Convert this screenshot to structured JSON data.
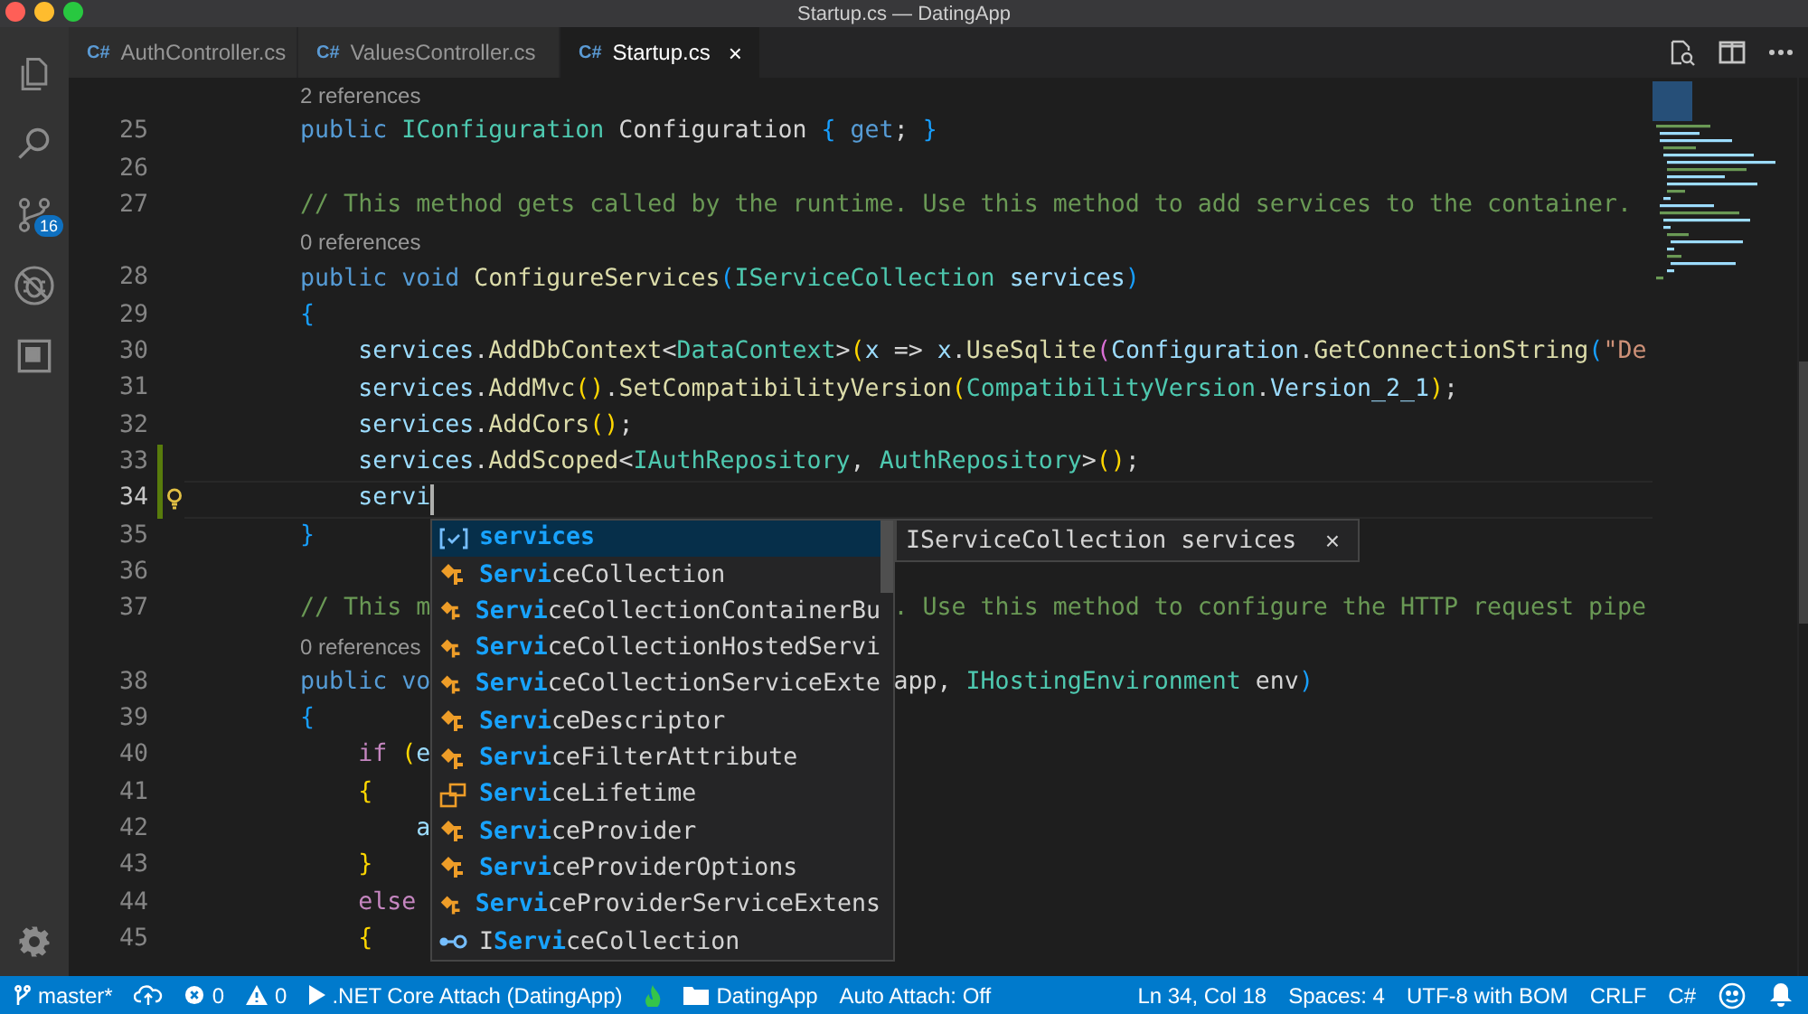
{
  "window": {
    "title": "Startup.cs — DatingApp"
  },
  "activity_bar": {
    "items": [
      {
        "kind": "files"
      },
      {
        "kind": "search"
      },
      {
        "kind": "source-control",
        "badge": "16"
      },
      {
        "kind": "debug"
      },
      {
        "kind": "extensions"
      }
    ],
    "bottom": [
      {
        "kind": "settings"
      }
    ]
  },
  "tabs": [
    {
      "icon": "C#",
      "label": "AuthController.cs",
      "selected": false
    },
    {
      "icon": "C#",
      "label": "ValuesController.cs",
      "selected": false
    },
    {
      "icon": "C#",
      "label": "Startup.cs",
      "selected": true,
      "close": "×"
    }
  ],
  "editor_actions": [
    {
      "kind": "find-in-file"
    },
    {
      "kind": "split"
    },
    {
      "kind": "more"
    }
  ],
  "editor": {
    "lines": [
      {
        "kind": "lens",
        "text": "2 references"
      },
      {
        "kind": "code",
        "number": "25",
        "tokens": [
          {
            "t": "        public ",
            "kind": "kw"
          },
          {
            "t": "IConfiguration",
            "kind": "type"
          },
          {
            "t": " Configuration ",
            "kind": "plain"
          },
          {
            "t": "{",
            "kind": "b3"
          },
          {
            "t": " get",
            "kind": "kw"
          },
          {
            "t": "; ",
            "kind": "plain"
          },
          {
            "t": "}",
            "kind": "b3"
          }
        ]
      },
      {
        "kind": "code",
        "number": "26"
      },
      {
        "kind": "code",
        "number": "27",
        "tokens": [
          {
            "t": "        // This method gets called by the runtime. Use this method to add services to the container.",
            "kind": "comment"
          }
        ]
      },
      {
        "kind": "lens",
        "text": "0 references"
      },
      {
        "kind": "code",
        "number": "28",
        "tokens": [
          {
            "t": "        public void ",
            "kind": "kw"
          },
          {
            "t": "ConfigureServices",
            "kind": "func"
          },
          {
            "t": "(",
            "kind": "b3"
          },
          {
            "t": "IServiceCollection",
            "kind": "type"
          },
          {
            "t": " services",
            "kind": "var"
          },
          {
            "t": ")",
            "kind": "b3"
          }
        ]
      },
      {
        "kind": "code",
        "number": "29",
        "tokens": [
          {
            "t": "        {",
            "kind": "b3"
          }
        ]
      },
      {
        "kind": "code",
        "number": "30",
        "tokens": [
          {
            "t": "            services",
            "kind": "var"
          },
          {
            "t": ".",
            "kind": "plain"
          },
          {
            "t": "AddDbContext",
            "kind": "func"
          },
          {
            "t": "<",
            "kind": "plain"
          },
          {
            "t": "DataContext",
            "kind": "type"
          },
          {
            "t": ">",
            "kind": "plain"
          },
          {
            "t": "(",
            "kind": "b1"
          },
          {
            "t": "x",
            "kind": "var"
          },
          {
            "t": " => ",
            "kind": "plain"
          },
          {
            "t": "x",
            "kind": "var"
          },
          {
            "t": ".",
            "kind": "plain"
          },
          {
            "t": "UseSqlite",
            "kind": "func"
          },
          {
            "t": "(",
            "kind": "b2"
          },
          {
            "t": "Configuration",
            "kind": "var"
          },
          {
            "t": ".",
            "kind": "plain"
          },
          {
            "t": "GetConnectionString",
            "kind": "func"
          },
          {
            "t": "(",
            "kind": "b3"
          },
          {
            "t": "\"De",
            "kind": "str"
          }
        ]
      },
      {
        "kind": "code",
        "number": "31",
        "tokens": [
          {
            "t": "            services",
            "kind": "var"
          },
          {
            "t": ".",
            "kind": "plain"
          },
          {
            "t": "AddMvc",
            "kind": "func"
          },
          {
            "t": "()",
            "kind": "b1"
          },
          {
            "t": ".",
            "kind": "plain"
          },
          {
            "t": "SetCompatibilityVersion",
            "kind": "func"
          },
          {
            "t": "(",
            "kind": "b1"
          },
          {
            "t": "CompatibilityVersion",
            "kind": "type"
          },
          {
            "t": ".",
            "kind": "plain"
          },
          {
            "t": "Version_2_1",
            "kind": "var"
          },
          {
            "t": ")",
            "kind": "b1"
          },
          {
            "t": ";",
            "kind": "plain"
          }
        ]
      },
      {
        "kind": "code",
        "number": "32",
        "tokens": [
          {
            "t": "            services",
            "kind": "var"
          },
          {
            "t": ".",
            "kind": "plain"
          },
          {
            "t": "AddCors",
            "kind": "func"
          },
          {
            "t": "()",
            "kind": "b1"
          },
          {
            "t": ";",
            "kind": "plain"
          }
        ]
      },
      {
        "kind": "code",
        "number": "33",
        "modified": true,
        "tokens": [
          {
            "t": "            services",
            "kind": "var"
          },
          {
            "t": ".",
            "kind": "plain"
          },
          {
            "t": "AddScoped",
            "kind": "func"
          },
          {
            "t": "<",
            "kind": "plain"
          },
          {
            "t": "IAuthRepository",
            "kind": "type"
          },
          {
            "t": ", ",
            "kind": "plain"
          },
          {
            "t": "AuthRepository",
            "kind": "type"
          },
          {
            "t": ">",
            "kind": "plain"
          },
          {
            "t": "()",
            "kind": "b1"
          },
          {
            "t": ";",
            "kind": "plain"
          }
        ]
      },
      {
        "kind": "code",
        "number": "34",
        "modified": true,
        "lightbulb": true,
        "cursor": true,
        "tokens": [
          {
            "t": "            servi",
            "kind": "var"
          }
        ]
      },
      {
        "kind": "code",
        "number": "35",
        "tokens": [
          {
            "t": "        }",
            "kind": "b3"
          }
        ]
      },
      {
        "kind": "code",
        "number": "36"
      },
      {
        "kind": "code",
        "number": "37",
        "tokens": [
          {
            "t": "        // This m",
            "kind": "comment"
          }
        ],
        "tail": [
          {
            "t": ". Use this method to configure the HTTP request pipe",
            "kind": "comment"
          }
        ]
      },
      {
        "kind": "lens",
        "text": "0 references"
      },
      {
        "kind": "code",
        "number": "38",
        "tokens": [
          {
            "t": "        public vo",
            "kind": "kw"
          }
        ],
        "tail": [
          {
            "t": "app, ",
            "kind": "plain"
          },
          {
            "t": "IHostingEnvironment",
            "kind": "type"
          },
          {
            "t": " env",
            "kind": "plain"
          },
          {
            "t": ")",
            "kind": "b3"
          }
        ]
      },
      {
        "kind": "code",
        "number": "39",
        "tokens": [
          {
            "t": "        {",
            "kind": "b3"
          }
        ]
      },
      {
        "kind": "code",
        "number": "40",
        "tokens": [
          {
            "t": "            if ",
            "kind": "ctrl"
          },
          {
            "t": "(",
            "kind": "b1"
          },
          {
            "t": "e",
            "kind": "var"
          }
        ]
      },
      {
        "kind": "code",
        "number": "41",
        "tokens": [
          {
            "t": "            {",
            "kind": "b1"
          }
        ]
      },
      {
        "kind": "code",
        "number": "42",
        "tokens": [
          {
            "t": "                a",
            "kind": "var"
          }
        ]
      },
      {
        "kind": "code",
        "number": "43",
        "tokens": [
          {
            "t": "            }",
            "kind": "b1"
          }
        ]
      },
      {
        "kind": "code",
        "number": "44",
        "tokens": [
          {
            "t": "            else",
            "kind": "ctrl"
          }
        ]
      },
      {
        "kind": "code",
        "number": "45",
        "tokens": [
          {
            "t": "            {",
            "kind": "b1"
          }
        ]
      }
    ]
  },
  "suggest": {
    "items": [
      {
        "kind": "variable",
        "match": "servi",
        "rest": "ces",
        "selected": true
      },
      {
        "kind": "class",
        "match": "Servi",
        "rest": "ceCollection",
        "selected": false
      },
      {
        "kind": "class",
        "match": "Servi",
        "rest": "ceCollectionContainerBu",
        "selected": false
      },
      {
        "kind": "class",
        "match": "Servi",
        "rest": "ceCollectionHostedServi",
        "selected": false
      },
      {
        "kind": "class",
        "match": "Servi",
        "rest": "ceCollectionServiceExte",
        "selected": false
      },
      {
        "kind": "class",
        "match": "Servi",
        "rest": "ceDescriptor",
        "selected": false
      },
      {
        "kind": "class",
        "match": "Servi",
        "rest": "ceFilterAttribute",
        "selected": false
      },
      {
        "kind": "enum",
        "match": "Servi",
        "rest": "ceLifetime",
        "selected": false
      },
      {
        "kind": "class",
        "match": "Servi",
        "rest": "ceProvider",
        "selected": false
      },
      {
        "kind": "class",
        "match": "Servi",
        "rest": "ceProviderOptions",
        "selected": false
      },
      {
        "kind": "class",
        "match": "Servi",
        "rest": "ceProviderServiceExtens",
        "selected": false
      },
      {
        "kind": "interface",
        "pre": "I",
        "match": "Servi",
        "rest": "ceCollection",
        "selected": false
      }
    ],
    "detail": {
      "text": "IServiceCollection services",
      "close": "×"
    }
  },
  "status_bar": {
    "left": [
      {
        "kind": "branch",
        "text": "master*"
      },
      {
        "kind": "cloud"
      },
      {
        "kind": "error",
        "text": "0"
      },
      {
        "kind": "warning",
        "text": "0"
      },
      {
        "kind": "play",
        "text": ".NET Core Attach (DatingApp)"
      },
      {
        "kind": "flame"
      },
      {
        "kind": "folder",
        "text": "DatingApp"
      },
      {
        "kind": "text",
        "text": "Auto Attach: Off"
      }
    ],
    "right": [
      {
        "kind": "text",
        "text": "Ln 34, Col 18"
      },
      {
        "kind": "text",
        "text": "Spaces: 4"
      },
      {
        "kind": "text",
        "text": "UTF-8 with BOM"
      },
      {
        "kind": "text",
        "text": "CRLF"
      },
      {
        "kind": "text",
        "text": "C#"
      },
      {
        "kind": "smiley"
      },
      {
        "kind": "bell"
      }
    ]
  }
}
